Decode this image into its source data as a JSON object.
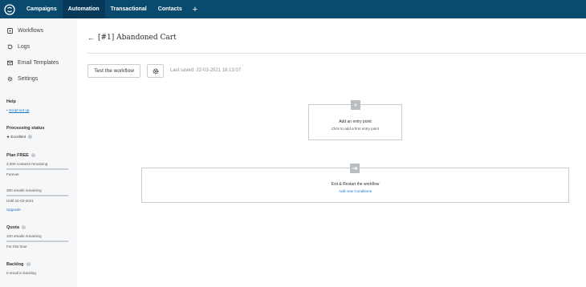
{
  "nav": {
    "tabs": [
      {
        "label": "Campaigns"
      },
      {
        "label": "Automation"
      },
      {
        "label": "Transactional"
      },
      {
        "label": "Contacts"
      }
    ],
    "add": "+",
    "colors": {
      "bar": "#0b4a6f",
      "active": "#063a58"
    }
  },
  "sidebar": {
    "items": [
      {
        "label": "Workflows",
        "icon": "workflows-icon"
      },
      {
        "label": "Logs",
        "icon": "logs-icon"
      },
      {
        "label": "Email Templates",
        "icon": "email-templates-icon"
      },
      {
        "label": "Settings",
        "icon": "gear-icon"
      }
    ],
    "help": {
      "heading": "Help",
      "link": "Script set up"
    },
    "processing": {
      "heading": "Processing status",
      "value": "Excellent"
    },
    "plan": {
      "heading": "Plan FREE",
      "contacts": "2,000 contacts remaining",
      "contacts_period": "Forever",
      "emails": "300 emails remaining",
      "emails_until": "Until 22-03-2021",
      "upgrade": "Upgrade"
    },
    "quota": {
      "heading": "Quota",
      "emails": "100 emails remaining",
      "period": "For this hour"
    },
    "backlog": {
      "heading": "Backlog",
      "value": "0 email in backlog"
    }
  },
  "main": {
    "back": "←",
    "title": "[#1] Abandoned Cart",
    "test_button": "Test the workflow",
    "last_saved": "Last saved: 22-03-2021 18:13:07",
    "entry": {
      "title": "Add an entry point",
      "subtitle": "Click to add a first entry point"
    },
    "exit": {
      "title": "Exit & Restart the workflow",
      "link": "Add new Conditions"
    }
  }
}
